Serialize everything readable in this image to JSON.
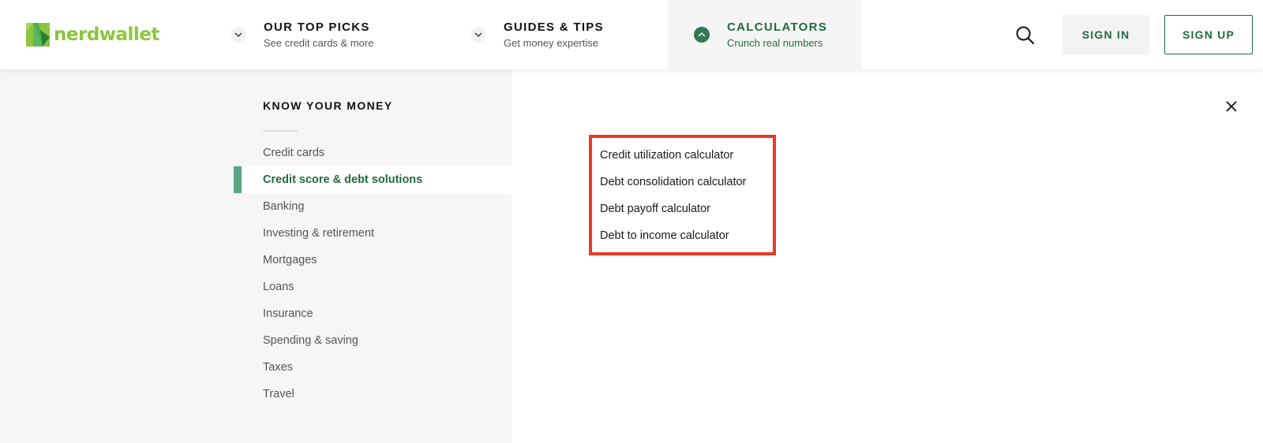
{
  "brand": {
    "name": "nerdwallet",
    "color": "#8cc63f"
  },
  "header": {
    "nav": [
      {
        "title": "OUR TOP PICKS",
        "subtitle": "See credit cards & more",
        "icon": "chevron-down-icon",
        "active": false
      },
      {
        "title": "GUIDES & TIPS",
        "subtitle": "Get money expertise",
        "icon": "chevron-down-icon",
        "active": false
      },
      {
        "title": "CALCULATORS",
        "subtitle": "Crunch real numbers",
        "icon": "chevron-up-icon",
        "active": true
      }
    ],
    "search_icon": "search-icon",
    "sign_in_label": "SIGN IN",
    "sign_up_label": "SIGN UP"
  },
  "dropdown": {
    "section_title": "KNOW YOUR MONEY",
    "categories": [
      {
        "label": "Credit cards",
        "selected": false
      },
      {
        "label": "Credit score & debt solutions",
        "selected": true
      },
      {
        "label": "Banking",
        "selected": false
      },
      {
        "label": "Investing & retirement",
        "selected": false
      },
      {
        "label": "Mortgages",
        "selected": false
      },
      {
        "label": "Loans",
        "selected": false
      },
      {
        "label": "Insurance",
        "selected": false
      },
      {
        "label": "Spending & saving",
        "selected": false
      },
      {
        "label": "Taxes",
        "selected": false
      },
      {
        "label": "Travel",
        "selected": false
      }
    ],
    "calculators": [
      "Credit utilization calculator",
      "Debt consolidation calculator",
      "Debt payoff calculator",
      "Debt to income calculator"
    ],
    "close_icon": "close-icon"
  },
  "colors": {
    "accent_green": "#1f6b3d",
    "selected_bar": "#5aa783",
    "highlight_box": "#e83a25",
    "panel_bg": "#f6f6f6"
  }
}
